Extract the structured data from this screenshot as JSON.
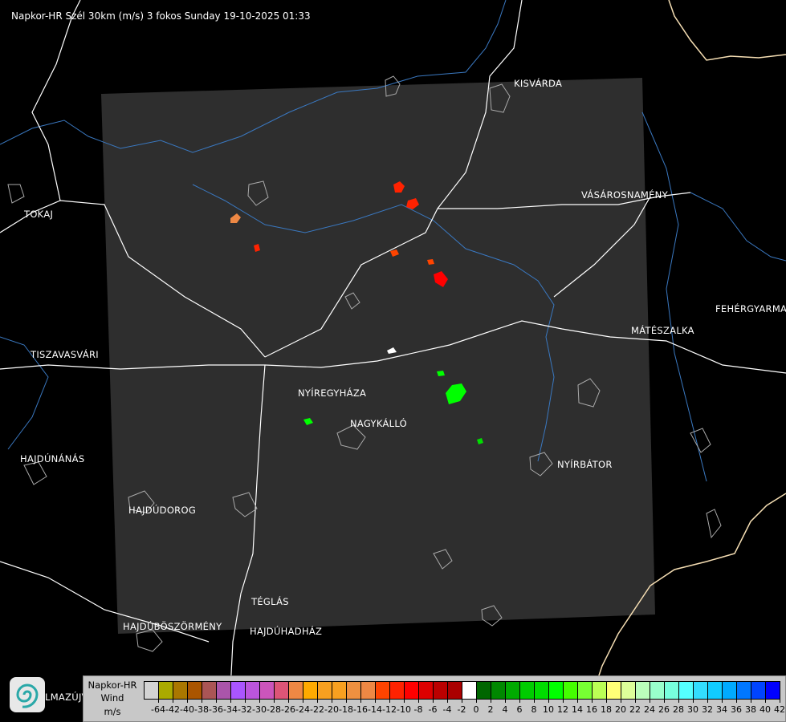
{
  "header": {
    "title": "Napkor-HR Szél 30km (m/s) 3 fokos Sunday 19-10-2025 01:33"
  },
  "cities": [
    {
      "name": "KISVÁRDA"
    },
    {
      "name": "VÁSÁROSNAMÉNY"
    },
    {
      "name": "TOKAJ"
    },
    {
      "name": "FEHÉRGYARMAT"
    },
    {
      "name": "MÁTÉSZALKA"
    },
    {
      "name": "TISZAVASVÁRI"
    },
    {
      "name": "NYÍREGYHÁZA"
    },
    {
      "name": "NAGYKÁLLÓ"
    },
    {
      "name": "HAJDÚNÁNÁS"
    },
    {
      "name": "NYÍRBÁTOR"
    },
    {
      "name": "HAJDÚDOROG"
    },
    {
      "name": "TÉGLÁS"
    },
    {
      "name": "HAJDÚBÖSZÖRMÉNY"
    },
    {
      "name": "HAJDÚHADHÁZ"
    },
    {
      "name": "LMAZÚJVÁR"
    }
  ],
  "legend": {
    "product": "Napkor-HR",
    "quantity": "Wind",
    "unit": "m/s",
    "colors": [
      "#d3d3d3",
      "#aaaa00",
      "#aa7700",
      "#aa5500",
      "#aa5555",
      "#aa55aa",
      "#aa55ff",
      "#bb55dd",
      "#cc55bb",
      "#dd5577",
      "#ee8844",
      "#ffaa00",
      "#f8a020",
      "#f8a020",
      "#ee9040",
      "#ee8844",
      "#ff4400",
      "#ff2200",
      "#ff0000",
      "#dd0000",
      "#bb0000",
      "#aa0000",
      "#ffffff",
      "#006600",
      "#008800",
      "#00aa00",
      "#00cc00",
      "#00dd00",
      "#00ff00",
      "#44ff00",
      "#77ff33",
      "#bbff55",
      "#ffff77",
      "#ddff99",
      "#bbffbb",
      "#99ffcc",
      "#77ffdd",
      "#55ffff",
      "#33ddff",
      "#11ccff",
      "#00aaff",
      "#0077ff",
      "#0044ff",
      "#0000ff"
    ],
    "ticks": [
      "-64",
      "-42",
      "-40",
      "-38",
      "-36",
      "-34",
      "-32",
      "-30",
      "-28",
      "-26",
      "-24",
      "-22",
      "-20",
      "-18",
      "-16",
      "-14",
      "-12",
      "-10",
      "-8",
      "-6",
      "-4",
      "-2",
      "0",
      "2",
      "4",
      "6",
      "8",
      "10",
      "12",
      "14",
      "16",
      "18",
      "20",
      "22",
      "24",
      "26",
      "28",
      "30",
      "32",
      "34",
      "36",
      "38",
      "40",
      "42"
    ]
  },
  "colors": {
    "radar_area": "#2e2e2e",
    "roads": "#ffffff",
    "rivers": "#3a78c0",
    "border": "#f5deb3",
    "background": "#000000"
  }
}
